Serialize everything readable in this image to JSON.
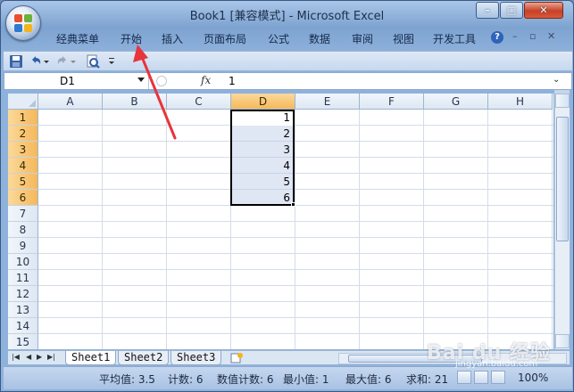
{
  "window": {
    "title": "Book1  [兼容模式] - Microsoft Excel",
    "minimize_icon": "minimize-icon",
    "maximize_icon": "restore-icon",
    "close_icon": "close-icon"
  },
  "ribbon": {
    "tabs": [
      {
        "label": "经典菜单"
      },
      {
        "label": "开始"
      },
      {
        "label": "插入"
      },
      {
        "label": "页面布局"
      },
      {
        "label": "公式"
      },
      {
        "label": "数据"
      },
      {
        "label": "审阅"
      },
      {
        "label": "视图"
      },
      {
        "label": "开发工具"
      }
    ],
    "help_label": "?"
  },
  "quick_access": {
    "items": [
      "save-icon",
      "undo-icon",
      "redo-icon",
      "print-preview-icon",
      "customize-dropdown-icon"
    ]
  },
  "formula_bar": {
    "name_box": "D1",
    "fx_label": "fx",
    "content": "1"
  },
  "sheet": {
    "columns": [
      "A",
      "B",
      "C",
      "D",
      "E",
      "F",
      "G",
      "H"
    ],
    "selected_column": "D",
    "rows": [
      "1",
      "2",
      "3",
      "4",
      "5",
      "6",
      "7",
      "8",
      "9",
      "10",
      "11",
      "12",
      "13",
      "14",
      "15"
    ],
    "selected_rows": [
      "1",
      "2",
      "3",
      "4",
      "5",
      "6"
    ],
    "cells_D": [
      "1",
      "2",
      "3",
      "4",
      "5",
      "6"
    ]
  },
  "sheet_tabs": {
    "tabs": [
      {
        "label": "Sheet1"
      },
      {
        "label": "Sheet2"
      },
      {
        "label": "Sheet3"
      }
    ],
    "active": "Sheet1"
  },
  "status_bar": {
    "average": "平均值: 3.5",
    "count": "计数: 6",
    "numeric_count": "数值计数: 6",
    "min": "最小值: 1",
    "max": "最大值: 6",
    "sum": "求和: 21",
    "zoom": "100%"
  },
  "annotation": {
    "arrow_color": "#e8343a",
    "watermark": "Bai du 经验",
    "watermark_sub": "jingyan.baidu.com"
  },
  "colors": {
    "accent": "#f5b85a",
    "header_bg": "#dde7f3",
    "selection_fill": "#bac9e6"
  }
}
